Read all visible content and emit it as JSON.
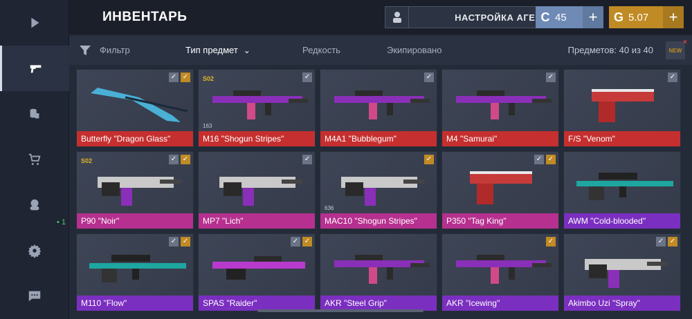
{
  "header": {
    "title": "ИНВЕНТАРЬ",
    "agent_button": "НАСТРОЙКА АГЕНТА",
    "silver": {
      "icon": "C",
      "value": "45",
      "plus": "+"
    },
    "gold": {
      "icon": "G",
      "value": "5.07",
      "plus": "+"
    }
  },
  "sidebar": {
    "items": [
      {
        "icon": "play-icon"
      },
      {
        "icon": "pistol-icon",
        "active": true
      },
      {
        "icon": "coins-icon"
      },
      {
        "icon": "cart-icon"
      },
      {
        "icon": "agent-icon",
        "badge": "• 1"
      },
      {
        "icon": "gear-icon"
      },
      {
        "icon": "chat-icon"
      }
    ]
  },
  "filterbar": {
    "filter": "Фильтр",
    "type": "Тип предмет",
    "rarity": "Редкость",
    "equipped": "Экипировано",
    "count": "Предметов: 40 из 40",
    "new_label": "NEW"
  },
  "items": [
    {
      "name": "Butterfly \"Dragon Glass\"",
      "color": "#c62f2f",
      "kind": "knife",
      "checks": [
        "gray",
        "gold"
      ]
    },
    {
      "name": "M16 \"Shogun Stripes\"",
      "color": "#c62f2f",
      "kind": "rifle",
      "checks": [
        "gray"
      ],
      "badge": "S02",
      "count": "163"
    },
    {
      "name": "M4A1 \"Bubblegum\"",
      "color": "#c62f2f",
      "kind": "rifle",
      "checks": [
        "gray"
      ]
    },
    {
      "name": "M4 \"Samurai\"",
      "color": "#c62f2f",
      "kind": "rifle",
      "checks": [
        "gray"
      ]
    },
    {
      "name": "F/S \"Venom\"",
      "color": "#c62f2f",
      "kind": "pistol",
      "checks": [
        "gray"
      ]
    },
    {
      "name": "P90 \"Noir\"",
      "color": "#b6308f",
      "kind": "smg",
      "checks": [
        "gray",
        "gold"
      ],
      "badge": "S02"
    },
    {
      "name": "MP7 \"Lich\"",
      "color": "#b6308f",
      "kind": "smg",
      "checks": [
        "gray"
      ]
    },
    {
      "name": "MAC10 \"Shogun Stripes\"",
      "color": "#b6308f",
      "kind": "smg",
      "checks": [
        "gold"
      ],
      "count": "636"
    },
    {
      "name": "P350 \"Tag King\"",
      "color": "#b6308f",
      "kind": "pistol",
      "checks": [
        "gray",
        "gold"
      ]
    },
    {
      "name": "AWM \"Cold-blooded\"",
      "color": "#7b2fc0",
      "kind": "sniper",
      "checks": []
    },
    {
      "name": "M110 \"Flow\"",
      "color": "#7b2fc0",
      "kind": "sniper",
      "checks": [
        "gray",
        "gold"
      ]
    },
    {
      "name": "SPAS \"Raider\"",
      "color": "#7b2fc0",
      "kind": "shotgun",
      "checks": [
        "gray",
        "gold"
      ]
    },
    {
      "name": "AKR \"Steel Grip\"",
      "color": "#7b2fc0",
      "kind": "rifle",
      "checks": []
    },
    {
      "name": "AKR \"Icewing\"",
      "color": "#7b2fc0",
      "kind": "rifle",
      "checks": [
        "gold"
      ]
    },
    {
      "name": "Akimbo Uzi \"Spray\"",
      "color": "#7b2fc0",
      "kind": "smg",
      "checks": [
        "gray",
        "gold"
      ]
    }
  ],
  "colors": {
    "accent_gold": "#c08a24",
    "accent_silver": "#6e8ab5",
    "arcane_red": "#c62f2f",
    "legendary_pink": "#b6308f",
    "epic_purple": "#7b2fc0"
  }
}
